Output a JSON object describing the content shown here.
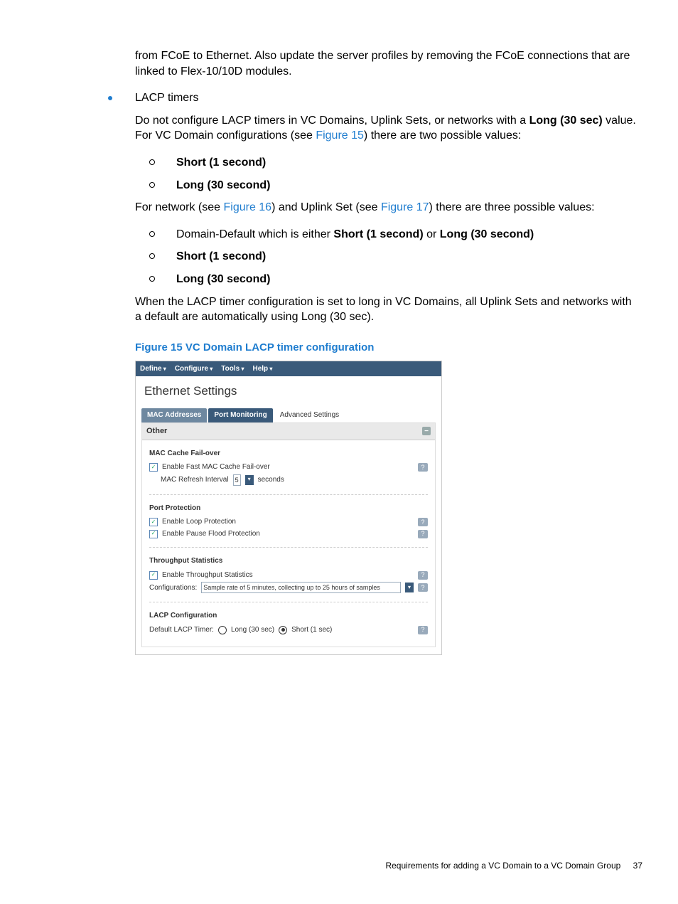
{
  "intro": "from FCoE to Ethernet. Also update the server profiles by removing the FCoE connections that are linked to Flex-10/10D modules.",
  "bullet1": "LACP timers",
  "para1a": "Do not configure LACP timers in VC Domains, Uplink Sets, or networks with a ",
  "para1b": "Long (30 sec)",
  "para1c": " value. For VC Domain configurations (see ",
  "link15": "Figure 15",
  "para1d": ") there are two possible values:",
  "sub1": "Short (1 second)",
  "sub2": "Long (30 second)",
  "para2a": "For network (see ",
  "link16": "Figure 16",
  "para2b": ") and Uplink Set (see ",
  "link17": "Figure 17",
  "para2c": ") there are three possible values:",
  "sub3a": "Domain-Default which is either ",
  "sub3b": "Short (1 second)",
  "sub3c": "  or ",
  "sub3d": "Long (30 second)",
  "sub4": "Short (1 second)",
  "sub5": "Long (30 second)",
  "para3": "When the LACP timer configuration is set to long in VC Domains, all Uplink Sets and networks with a default are automatically using Long (30 sec).",
  "figlabel": "Figure 15 VC Domain LACP timer configuration",
  "ui": {
    "menu": [
      "Define",
      "Configure",
      "Tools",
      "Help"
    ],
    "title": "Ethernet Settings",
    "tabs": [
      "MAC Addresses",
      "Port Monitoring",
      "Advanced Settings"
    ],
    "panel": "Other",
    "s1": "MAC Cache Fail-over",
    "s1a": "Enable Fast MAC Cache Fail-over",
    "s1b": "MAC Refresh Interval",
    "s1val": "5",
    "s1unit": "seconds",
    "s2": "Port Protection",
    "s2a": "Enable Loop Protection",
    "s2b": "Enable Pause Flood Protection",
    "s3": "Throughput Statistics",
    "s3a": "Enable Throughput Statistics",
    "s3b": "Configurations:",
    "s3c": "Sample rate of 5 minutes, collecting up to 25 hours of samples",
    "s4": "LACP Configuration",
    "s4a": "Default LACP Timer:",
    "s4b": "Long (30 sec)",
    "s4c": "Short (1 sec)"
  },
  "footer": "Requirements for adding a VC Domain to a VC Domain Group",
  "pagenum": "37"
}
